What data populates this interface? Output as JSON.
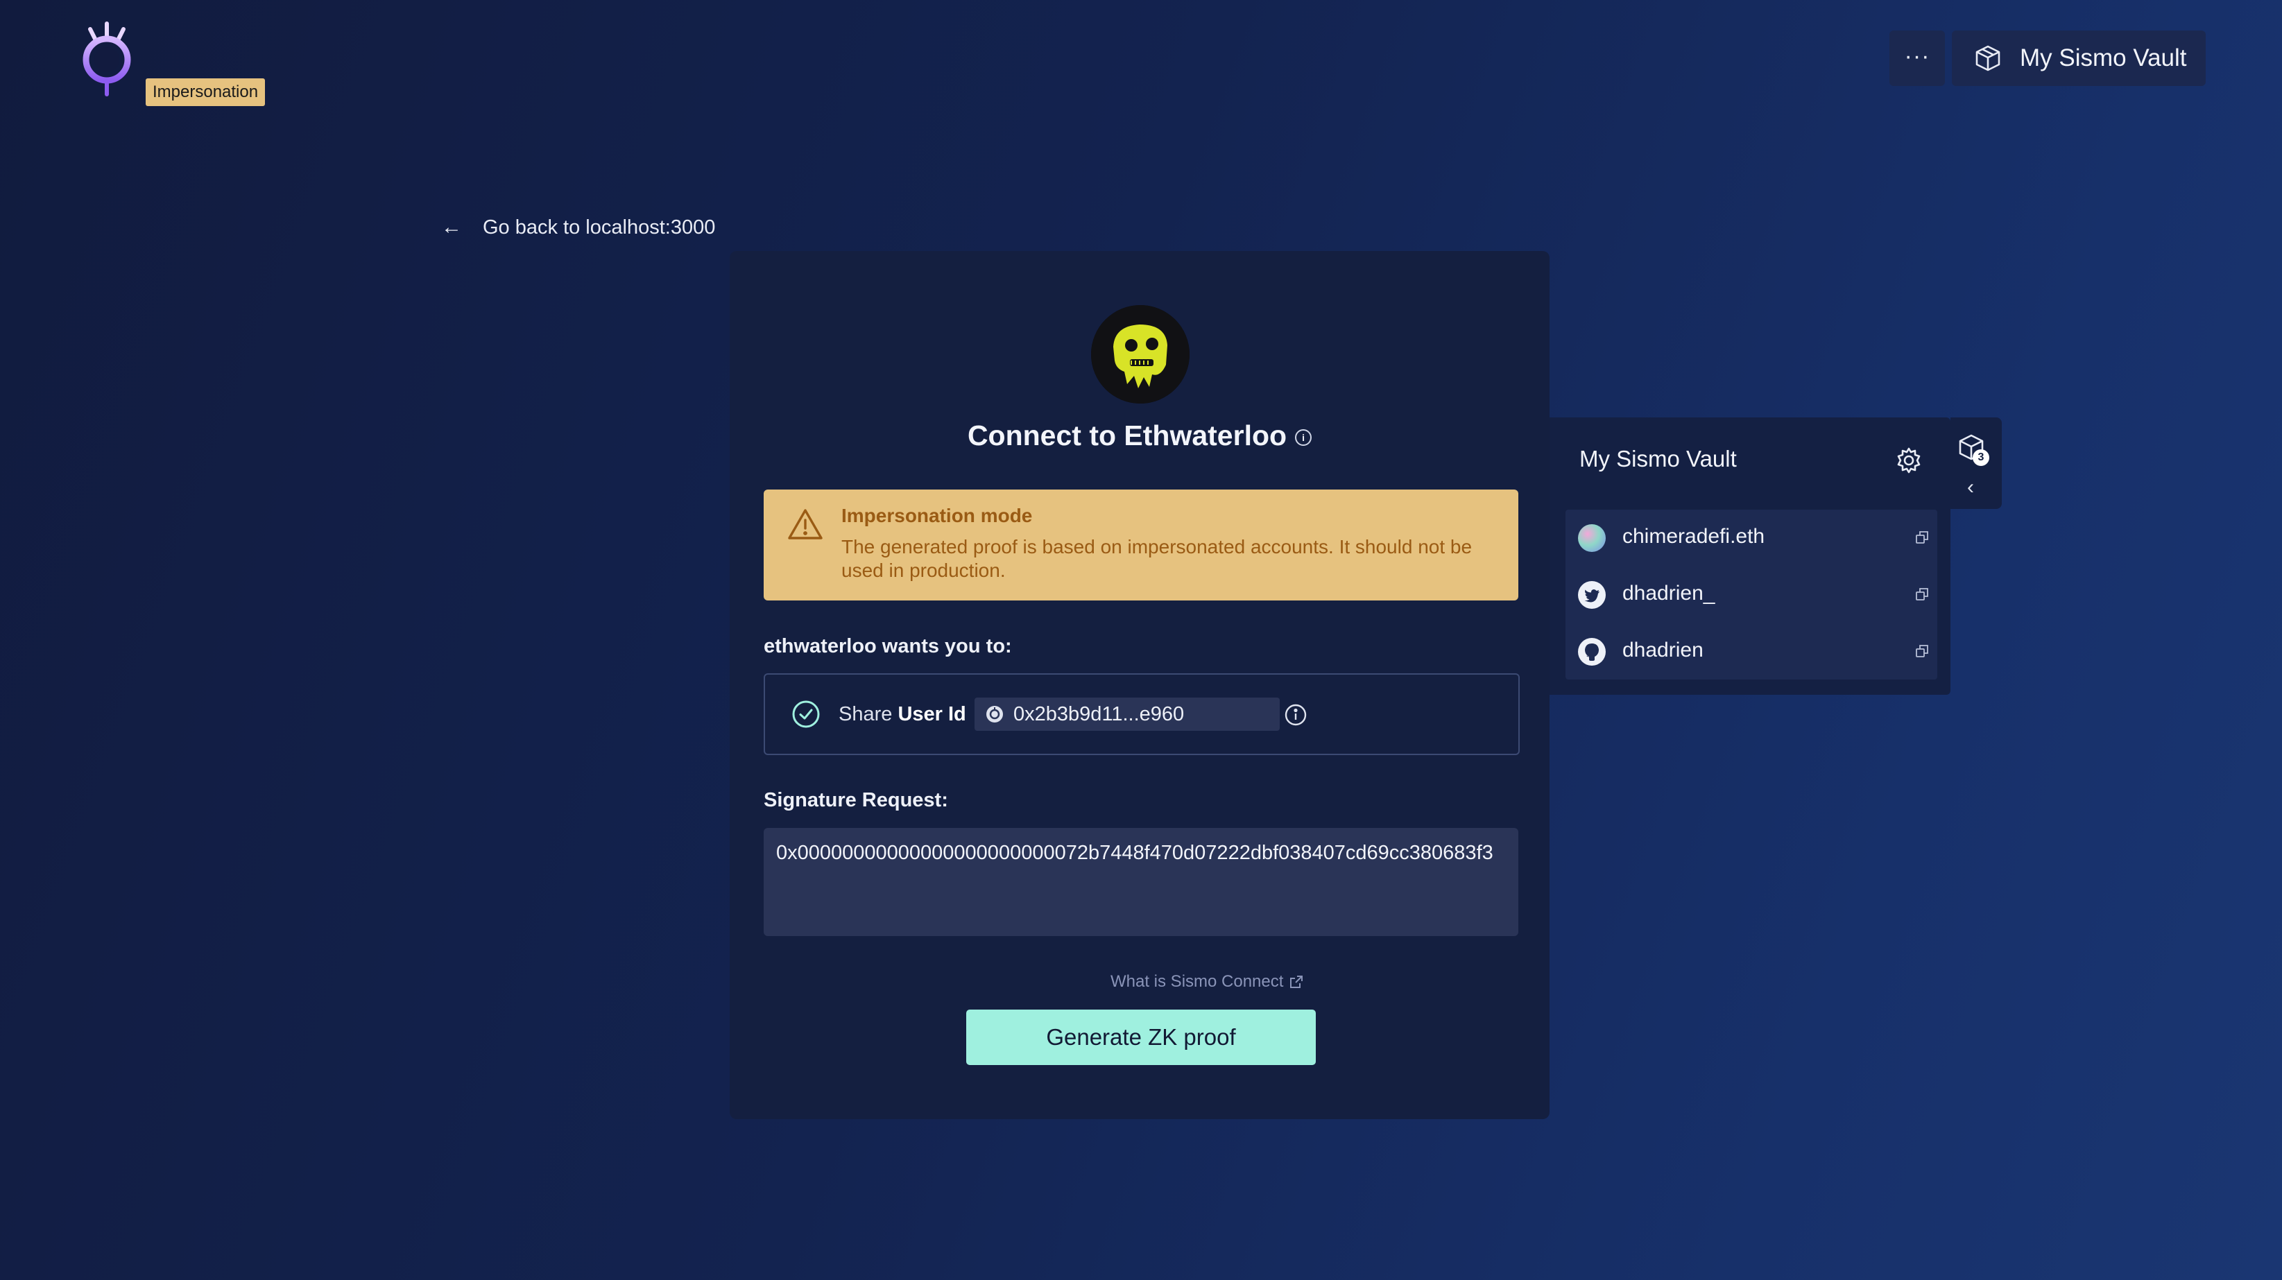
{
  "header": {
    "badge": "Impersonation",
    "more_label": "···",
    "vault_button_label": "My Sismo Vault"
  },
  "back_link": {
    "label": "Go back to localhost:3000"
  },
  "card": {
    "title": "Connect to Ethwaterloo",
    "warning": {
      "title": "Impersonation mode",
      "text": "The generated proof is based on impersonated accounts. It should not be used in production."
    },
    "wants_label": "ethwaterloo wants you to:",
    "request": {
      "prefix": "Share",
      "item": "User Id",
      "value": "0x2b3b9d11...e960"
    },
    "signature_label": "Signature Request:",
    "signature_value": "0x00000000000000000000000072b7448f470d07222dbf038407cd69cc380683f3",
    "what_link": "What is Sismo Connect",
    "generate_button": "Generate ZK proof"
  },
  "vault_panel": {
    "title": "My Sismo Vault",
    "badge_count": "3",
    "chevron": "‹",
    "accounts": [
      {
        "name": "chimeradefi.eth",
        "icon": "ethereum-avatar-icon"
      },
      {
        "name": "dhadrien_",
        "icon": "twitter-icon"
      },
      {
        "name": "dhadrien",
        "icon": "github-icon"
      }
    ]
  },
  "colors": {
    "accent": "#9ff0df",
    "warning_bg": "#e6c27f",
    "warning_text": "#9a5b14",
    "card_bg": "#141f40",
    "logo": "#b58af0"
  }
}
